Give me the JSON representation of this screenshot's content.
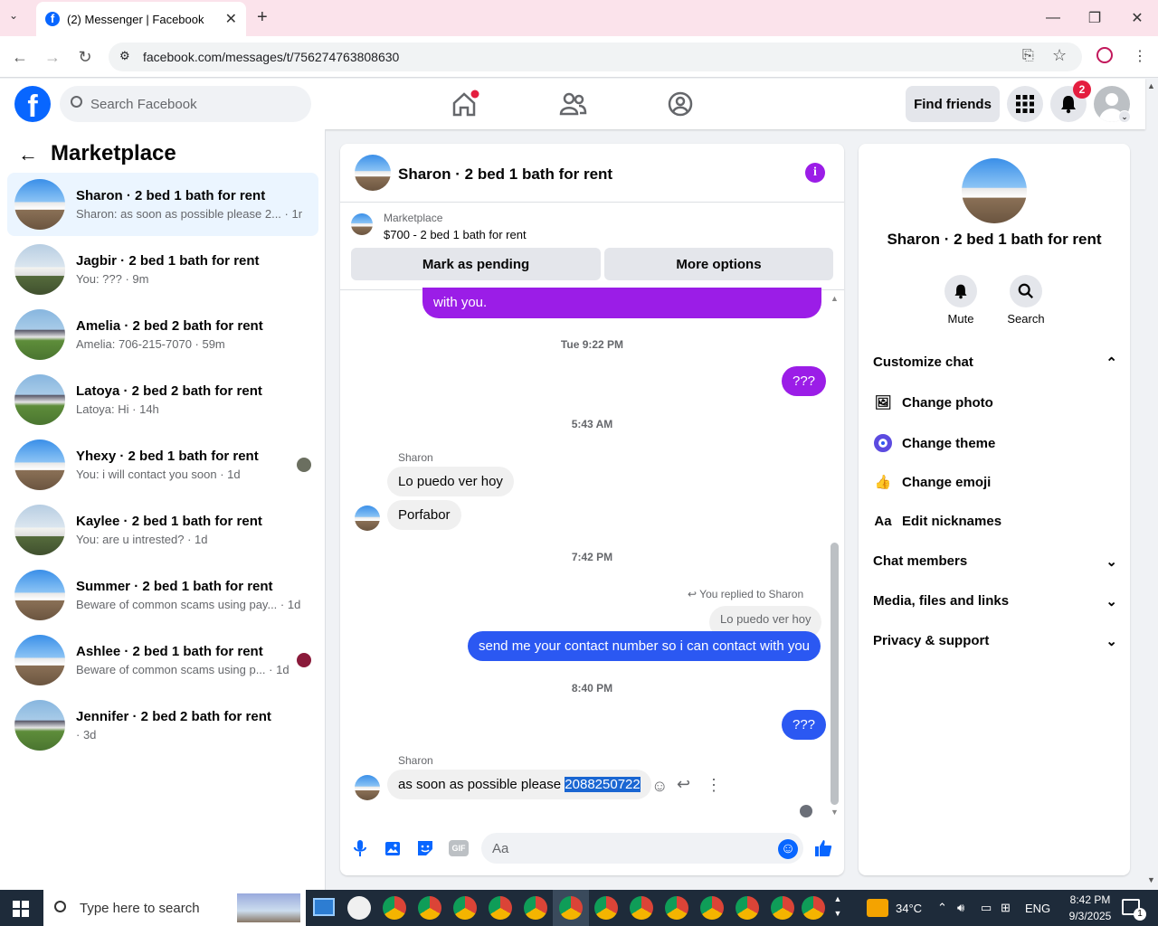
{
  "browser": {
    "tab_title": "(2) Messenger | Facebook",
    "url": "facebook.com/messages/t/756274763808630"
  },
  "fb_header": {
    "search_placeholder": "Search Facebook",
    "find_friends": "Find friends",
    "notif_count": "2"
  },
  "left": {
    "title": "Marketplace",
    "conversations": [
      {
        "name": "Sharon · 2 bed 1 bath for rent",
        "preview": "Sharon: as soon as possible please 2... · 1m"
      },
      {
        "name": "Jagbir · 2 bed 1 bath for rent",
        "preview": "You: ??? · 9m"
      },
      {
        "name": "Amelia · 2 bed 2 bath for rent",
        "preview": "Amelia: 706-215-7070 · 59m"
      },
      {
        "name": "Latoya · 2 bed 2 bath for rent",
        "preview": "Latoya: Hi · 14h"
      },
      {
        "name": "Yhexy · 2 bed 1 bath for rent",
        "preview": "You: i will contact you soon · 1d"
      },
      {
        "name": "Kaylee · 2 bed 1 bath for rent",
        "preview": "You: are u intrested? · 1d"
      },
      {
        "name": "Summer · 2 bed 1 bath for rent",
        "preview": "Beware of common scams using pay... · 1d"
      },
      {
        "name": "Ashlee · 2 bed 1 bath for rent",
        "preview": "Beware of common scams using p... · 1d"
      },
      {
        "name": "Jennifer · 2 bed 2 bath for rent",
        "preview": " · 3d"
      }
    ]
  },
  "chat": {
    "title": "Sharon · 2 bed 1 bath for rent",
    "marketplace_label": "Marketplace",
    "listing": "$700 - 2 bed 1 bath for rent",
    "mark_pending": "Mark as pending",
    "more_options": "More options",
    "msg_top": "with you.",
    "ts1": "Tue 9:22 PM",
    "msg_q1": "???",
    "ts2": "5:43 AM",
    "sender1": "Sharon",
    "msg_in1": "Lo puedo ver hoy",
    "msg_in2": "Porfabor",
    "ts3": "7:42 PM",
    "replied_to": "You replied to Sharon",
    "quoted": "Lo puedo ver hoy",
    "msg_out_blue": "send me your contact number so i can contact with you",
    "ts4": "8:40 PM",
    "msg_q2": "???",
    "sender2": "Sharon",
    "msg_last": "as soon as possible please ",
    "msg_last_sel": "2088250722",
    "composer_placeholder": "Aa"
  },
  "right": {
    "name": "Sharon · 2 bed 1 bath for rent",
    "mute": "Mute",
    "search": "Search",
    "customize": "Customize chat",
    "change_photo": "Change photo",
    "change_theme": "Change theme",
    "change_emoji": "Change emoji",
    "edit_nicknames": "Edit nicknames",
    "nick_icon_text": "Aa",
    "chat_members": "Chat members",
    "media": "Media, files and links",
    "privacy": "Privacy & support"
  },
  "taskbar": {
    "search_placeholder": "Type here to search",
    "temp": "34°C",
    "lang": "ENG",
    "time": "8:42 PM",
    "date": "9/3/2025",
    "notif": "1"
  },
  "colors": {
    "fb_blue": "#0866ff",
    "purple_bubble": "#9b1de7",
    "blue_bubble": "#2b58f2"
  }
}
